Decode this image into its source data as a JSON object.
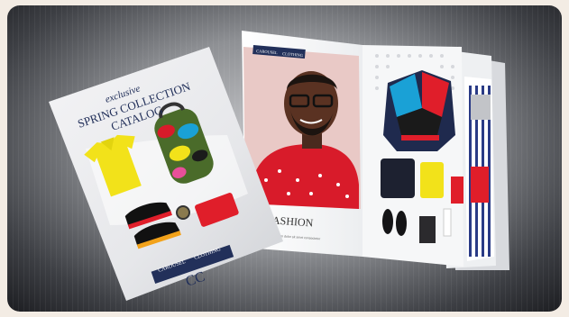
{
  "cover": {
    "script_title": "exclusive",
    "title_line1": "SPRING COLLECTION",
    "title_line2": "CATALOG",
    "brand_left": "CAROUSEL",
    "brand_right": "CLOTHING",
    "monogram": "CC"
  },
  "spread": {
    "brand_left": "CAROUSEL",
    "brand_right": "CLOTHING",
    "heading": "FASHION",
    "caption": "Lorem ipsum dolor sit amet consectetur"
  },
  "colors": {
    "navy": "#22305a",
    "yellow": "#f2e21a",
    "red": "#e01e2a",
    "pink": "#e9c9c6"
  }
}
